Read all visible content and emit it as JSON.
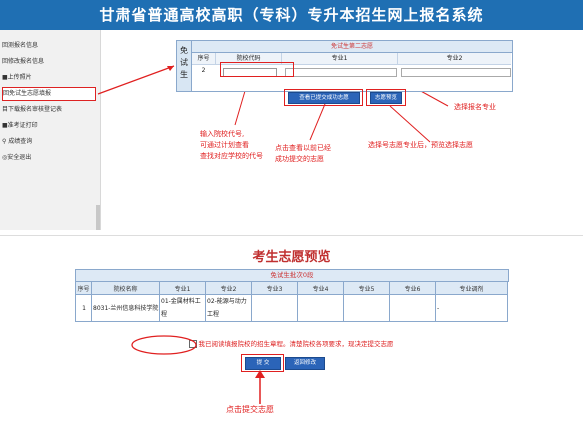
{
  "header": {
    "title": "甘肃省普通高校高职（专科）专升本招生网上报名系统"
  },
  "sidebar": {
    "items": [
      {
        "icon": "list-icon",
        "label": "回测报名信息"
      },
      {
        "icon": "edit-icon",
        "label": "回修改报名信息"
      },
      {
        "icon": "upload-icon",
        "label": "■上传照片"
      },
      {
        "icon": "edit-icon",
        "label": "回免试生志愿填报"
      },
      {
        "icon": "print-icon",
        "label": "目下载报名审核登记表"
      },
      {
        "icon": "print-icon",
        "label": "■准考证打印"
      },
      {
        "icon": "check-icon",
        "label": "⚲ 成绩查询"
      },
      {
        "icon": "exit-icon",
        "label": "◎安全退出"
      }
    ]
  },
  "form": {
    "side_label": [
      "免",
      "试",
      "生"
    ],
    "heading": "免试生第二志愿",
    "columns": [
      "序号",
      "院校代码",
      "专业1",
      "专业2"
    ],
    "row": {
      "index": "2",
      "code_value": "",
      "major1": "",
      "major2": ""
    },
    "buttons": {
      "view_submitted": "查看已提交成功志愿",
      "preview": "志愿预览"
    }
  },
  "annotations": {
    "select_major": "选择报名专业",
    "enter_code": [
      "输入院校代号,",
      "可通过计划查看",
      "查找对应学校的代号"
    ],
    "view_prev": [
      "点击查看以前已经",
      "成功提交的志愿"
    ],
    "preview_hint": "选择号志愿专业后，预览选择志愿",
    "click_submit": "点击提交志愿"
  },
  "preview": {
    "title": "考生志愿预览",
    "subtitle": "免试生批次0段",
    "columns": [
      "序号",
      "院校名称",
      "专业1",
      "专业2",
      "专业3",
      "专业4",
      "专业5",
      "专业6",
      "专业调剂"
    ],
    "rows": [
      {
        "index": "1",
        "school": "8031-兰州信息科技学院",
        "m1": "01-金属材料工程",
        "m2": "02-能源与动力工程",
        "m3": "",
        "m4": "",
        "m5": "",
        "m6": "",
        "adjust": "-"
      }
    ],
    "agreement": "我已阅读填报院校的招生章程。清楚院校各项要求，现决定提交志愿",
    "buttons": {
      "submit": "提 交",
      "back": "返回修改"
    }
  }
}
